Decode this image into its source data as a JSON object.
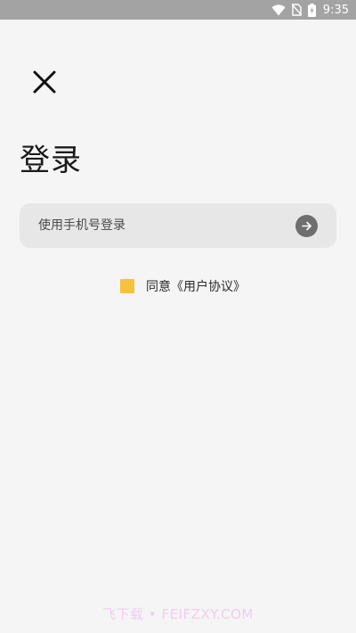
{
  "status_bar": {
    "time": "9:35",
    "icons": [
      "wifi-icon",
      "no-sim-icon",
      "battery-charging-icon"
    ]
  },
  "header": {
    "close_icon": "close-icon"
  },
  "login": {
    "title": "登录",
    "phone_login_label": "使用手机号登录",
    "arrow_icon": "arrow-right-icon"
  },
  "agreement": {
    "checkbox_color": "#f6c13c",
    "agree_text": "同意",
    "link_text": "《用户协议》"
  },
  "watermark": {
    "text": "飞下载 • FEIFZXY.COM"
  },
  "colors": {
    "background": "#f5f5f5",
    "status_bar": "#a3a3a3",
    "input_bg": "#e7e7e7",
    "arrow_circle": "#6e6e6e",
    "accent": "#f6c13c"
  }
}
